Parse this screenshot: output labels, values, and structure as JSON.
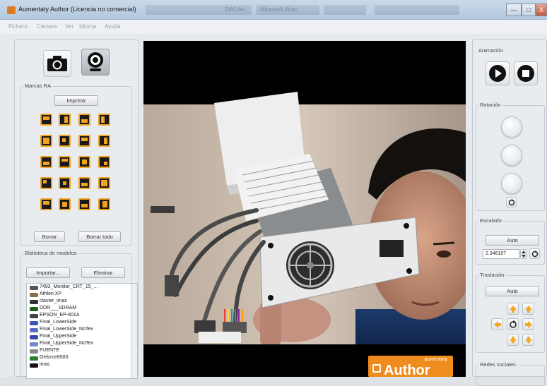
{
  "window": {
    "title": "Aumentaty Author (Licencia no comercial)",
    "taskbar_blur_1": "SWLdef",
    "taskbar_blur_2": "Microsoft Word",
    "min_label": "—",
    "max_label": "□",
    "close_label": "X"
  },
  "menu": [
    "Fichero",
    "Cámara",
    "Ver",
    "Idioma",
    "Ayuda"
  ],
  "left_panel": {
    "markers_group_label": "Marcas RA",
    "print_button": "Imprimir",
    "delete_button": "Borrar",
    "delete_all_button": "Borrar todo",
    "library_group_label": "Biblioteca de modelos",
    "import_button": "Importar...",
    "remove_button": "Eliminar",
    "models": [
      "7493_Monitor_CRT_15_...",
      "Athlon XP",
      "clavier_imac",
      "DDR___SDRAM",
      "EPSON_EP-801A",
      "Final_LowerSide",
      "Final_LowerSide_NoTex",
      "Final_UpperSide",
      "Final_UpperSide_NoTex",
      "FUENTE",
      "Geforce8500",
      "imac"
    ]
  },
  "viewport": {
    "logo_top": "aumentaty",
    "logo_main": "Author"
  },
  "right_panel": {
    "animation_label": "Animación",
    "rotation_label": "Rotación",
    "scale_label": "Escalado",
    "scale_auto_button": "Auto",
    "scale_value": "2.346107",
    "translation_label": "Traslación",
    "translation_auto_button": "Auto",
    "social_label": "Redes sociales"
  },
  "colors": {
    "accent_orange": "#f2a21c",
    "logo_orange": "#f08b1d",
    "arrow_orange": "#f5a623"
  }
}
